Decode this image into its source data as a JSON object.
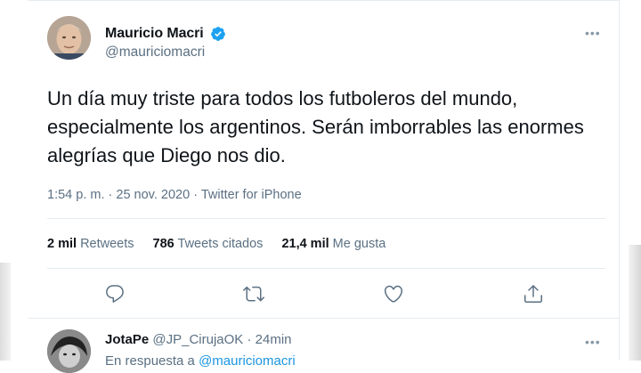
{
  "tweet": {
    "author_name": "Mauricio Macri",
    "author_handle": "@mauriciomacri",
    "verified": true,
    "text": "Un día muy triste para todos los futboleros del mundo, especialmente los argentinos. Serán imborrables las enormes alegrías que Diego nos dio.",
    "time": "1:54 p. m.",
    "separator": "·",
    "date": "25 nov. 2020",
    "source": "Twitter for iPhone",
    "more_icon": "more-horizontal-icon"
  },
  "stats": {
    "retweets_count": "2 mil",
    "retweets_label": "Retweets",
    "quotes_count": "786",
    "quotes_label": "Tweets citados",
    "likes_count": "21,4 mil",
    "likes_label": "Me gusta"
  },
  "actions": [
    {
      "name": "reply",
      "icon": "reply-icon"
    },
    {
      "name": "retweet",
      "icon": "retweet-icon"
    },
    {
      "name": "like",
      "icon": "heart-icon"
    },
    {
      "name": "share",
      "icon": "share-icon"
    }
  ],
  "reply": {
    "author_name": "JotaPe",
    "author_handle": "@JP_CirujaOK",
    "separator": "·",
    "time_ago": "24min",
    "in_reply_prefix": "En respuesta a",
    "in_reply_mention": "@mauriciomacri"
  },
  "colors": {
    "text": "#0f1419",
    "secondary": "#5b7083",
    "verified": "#1da1f2",
    "link": "#1b95e0",
    "border": "#e6ecf0"
  }
}
